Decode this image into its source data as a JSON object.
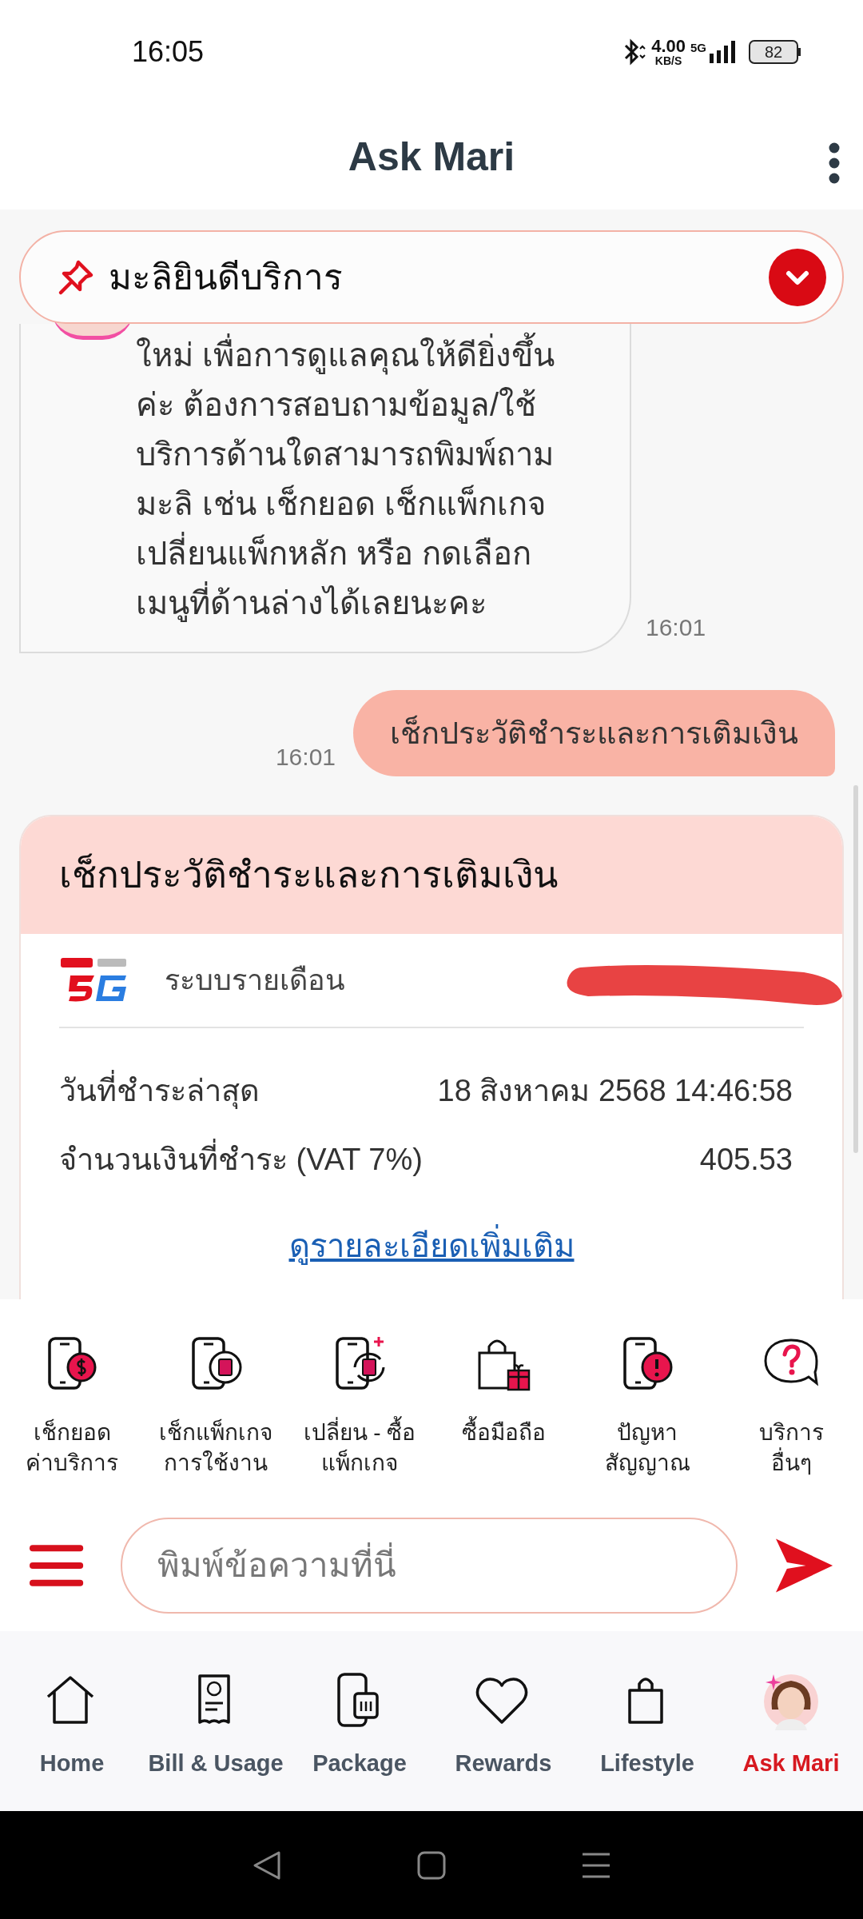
{
  "status_bar": {
    "time": "16:05",
    "speed": "4.00",
    "speed_unit": "KB/S",
    "network": "5G",
    "battery": "82"
  },
  "header": {
    "title": "Ask Mari"
  },
  "pinned": {
    "label": "มะลิยินดีบริการ"
  },
  "messages": [
    {
      "kind": "bot",
      "lines": [
        "ใหม่ เพื่อการดูแลคุณให้ดียิ่งขึ้น",
        "ค่ะ ต้องการสอบถามข้อมูล/ใช้",
        "บริการด้านใดสามารถพิมพ์ถาม",
        "มะลิ เช่น เช็กยอด เช็กแพ็กเกจ",
        "เปลี่ยนแพ็กหลัก หรือ กดเลือก",
        "เมนูที่ด้านล่างได้เลยนะคะ"
      ],
      "time": "16:01"
    },
    {
      "kind": "user",
      "text": "เช็กประวัติชำระและการเติมเงิน",
      "time": "16:01"
    }
  ],
  "card": {
    "title": "เช็กประวัติชำระและการเติมเงิน",
    "plan": "ระบบรายเดือน",
    "rows": [
      {
        "label": "วันที่ชำระล่าสุด",
        "value": "18 สิงหาคม 2568 14:46:58"
      },
      {
        "label": "จำนวนเงินที่ชำระ (VAT 7%)",
        "value": "405.53"
      }
    ],
    "link": "ดูรายละเอียดเพิ่มเติม"
  },
  "quick_menu": [
    {
      "kind": "balance",
      "label": "เช็กยอด\nค่าบริการ"
    },
    {
      "kind": "package",
      "label": "เช็กแพ็กเกจ\nการใช้งาน"
    },
    {
      "kind": "change",
      "label": "เปลี่ยน - ซื้อ\nแพ็กเกจ"
    },
    {
      "kind": "shop",
      "label": "ซื้อมือถือ"
    },
    {
      "kind": "signal",
      "label": "ปัญหา\nสัญญาณ"
    },
    {
      "kind": "other",
      "label": "บริการ\nอื่นๆ"
    }
  ],
  "input": {
    "placeholder": "พิมพ์ข้อความที่นี่"
  },
  "bottom_nav": [
    {
      "kind": "home",
      "label": "Home",
      "selected": false
    },
    {
      "kind": "bill",
      "label": "Bill & Usage",
      "selected": false
    },
    {
      "kind": "package",
      "label": "Package",
      "selected": false
    },
    {
      "kind": "rewards",
      "label": "Rewards",
      "selected": false
    },
    {
      "kind": "lifestyle",
      "label": "Lifestyle",
      "selected": false
    },
    {
      "kind": "avatar",
      "label": "Ask Mari",
      "selected": true
    }
  ]
}
